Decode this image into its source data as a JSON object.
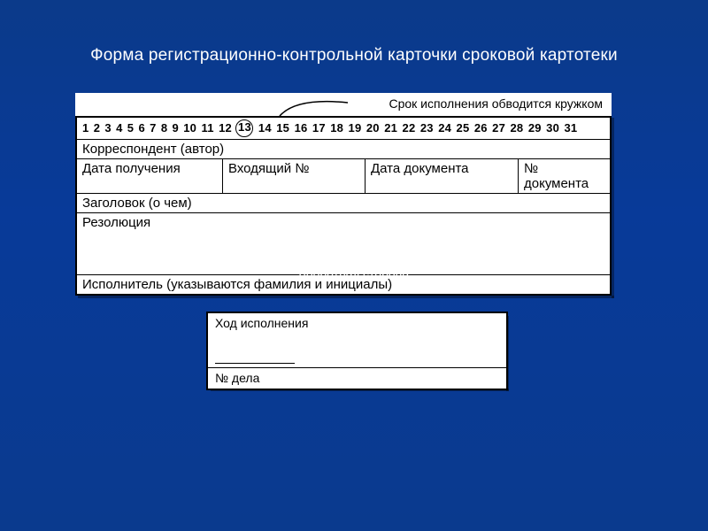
{
  "title": "Форма регистрационно-контрольной карточки сроковой картотеки",
  "annotation": "Срок исполнения обводится кружком",
  "days": [
    "1",
    "2",
    "3",
    "4",
    "5",
    "6",
    "7",
    "8",
    "9",
    "10",
    "11",
    "12",
    "13",
    "14",
    "15",
    "16",
    "17",
    "18",
    "19",
    "20",
    "21",
    "22",
    "23",
    "24",
    "25",
    "26",
    "27",
    "28",
    "29",
    "30",
    "31"
  ],
  "circled_day": "13",
  "front": {
    "correspondent": "Корреспондент (автор)",
    "cols": {
      "received": "Дата получения",
      "incoming_no": "Входящий №",
      "doc_date": "Дата документа",
      "doc_no": "№ документа"
    },
    "subject": "Заголовок (о чем)",
    "resolution": "Резолюция",
    "executor": "Исполнитель (указываются фамилия и инициалы)"
  },
  "caption": "оборотная сторона",
  "back": {
    "progress": "Ход исполнения",
    "case_no": "№ дела"
  }
}
